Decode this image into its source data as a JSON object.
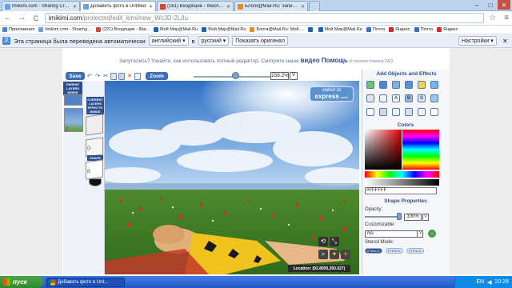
{
  "tabs": [
    {
      "title": "Imikimi.com - Sharing Creat",
      "color": "#6fa0d8",
      "active": false
    },
    {
      "title": "Добавить фото в Untitled",
      "color": "#6fa0d8",
      "active": true
    },
    {
      "title": "(161) Входящие - Wacheva",
      "color": "#d44638",
      "active": false
    },
    {
      "title": "Блоги@Mail.Ru: Запись но",
      "color": "#e48c1f",
      "active": false
    }
  ],
  "window_controls": {
    "minimize": "–",
    "maximize": "□",
    "close": "✕"
  },
  "toolbar": {
    "back": "←",
    "forward": "→",
    "reload": "C",
    "url_host": "imikimi.com",
    "url_path": "/protected/edit_kimi/new_WcJD-2LIIu"
  },
  "bookmarks": [
    {
      "label": "Приложения",
      "color": "#4a86d8"
    },
    {
      "label": "Imikimi.com - Sharing ...",
      "color": "#6fa0d8"
    },
    {
      "label": "(221) Входящие - 8ka...",
      "color": "#d44638"
    },
    {
      "label": "Мой Мир@Mail.Ru",
      "color": "#1f5fb8"
    },
    {
      "label": "Мой Мир@Mail.Ru",
      "color": "#1f5fb8"
    },
    {
      "label": "Блоги@Mail.Ru: Мой ...",
      "color": "#e48c1f"
    },
    {
      "label": "",
      "color": "#1f5fb8"
    },
    {
      "label": "Мой Мир@Mail.Ru",
      "color": "#1f5fb8"
    },
    {
      "label": "Почта",
      "color": "#3d70c5"
    },
    {
      "label": "Яндекс",
      "color": "#d8262b"
    },
    {
      "label": "Почта",
      "color": "#3d70c5"
    },
    {
      "label": "Яндекс",
      "color": "#d8262b"
    }
  ],
  "translate_bar": {
    "message": "Эта страница была переведена автоматически",
    "from_lang": "английский",
    "to": "в",
    "to_lang": "русский",
    "show_original": "Показать оригинал",
    "settings": "Настройки"
  },
  "hint": {
    "text": "Запутались? Узнайте, как использовать полный редактор. Смотрите наше",
    "link": "видео Помощь",
    "small": "установки плагина FAQ"
  },
  "editor": {
    "save": "Save",
    "zoom": "Zoom",
    "zoom_value": "158.2%",
    "zoom_dropdown": "V",
    "zoom_fraction": 0.5,
    "tool_icons": [
      "undo-icon",
      "redo-icon",
      "cut-icon",
      "copy-icon",
      "paste-icon",
      "delete-icon",
      "crop-icon"
    ]
  },
  "layers": {
    "parent_header": "PARENT LAYERS INSIDE",
    "current_header": "CURRENT LAYERS EFFECTS INSIDE",
    "shape_header": "SHAPE",
    "letters": [
      "F",
      "G",
      "B"
    ]
  },
  "express": {
    "line1": "switch to",
    "line2": "express",
    "line3": "mode"
  },
  "location": "Location: (92.8005,350.027)",
  "right_panel": {
    "add_title": "Add Objects and Effects",
    "tile_letters": [
      "A",
      "B",
      "S"
    ],
    "colors_title": "Colors",
    "hex": "#FFFFFF",
    "shape_title": "Shape Properties",
    "opacity_label": "Opacity:",
    "opacity_value": "100%",
    "opacity_fraction": 1.0,
    "customizable_label": "Customizable:",
    "customizable_value": "No",
    "stencil_label": "Stencil Mode:",
    "stencil_buttons": [
      "STENCIL",
      "STENCIL",
      "STENCIL"
    ]
  },
  "taskbar": {
    "start": "пуск",
    "task": "Добавить фото в Unt...",
    "lang": "EN",
    "time": "20:28"
  }
}
